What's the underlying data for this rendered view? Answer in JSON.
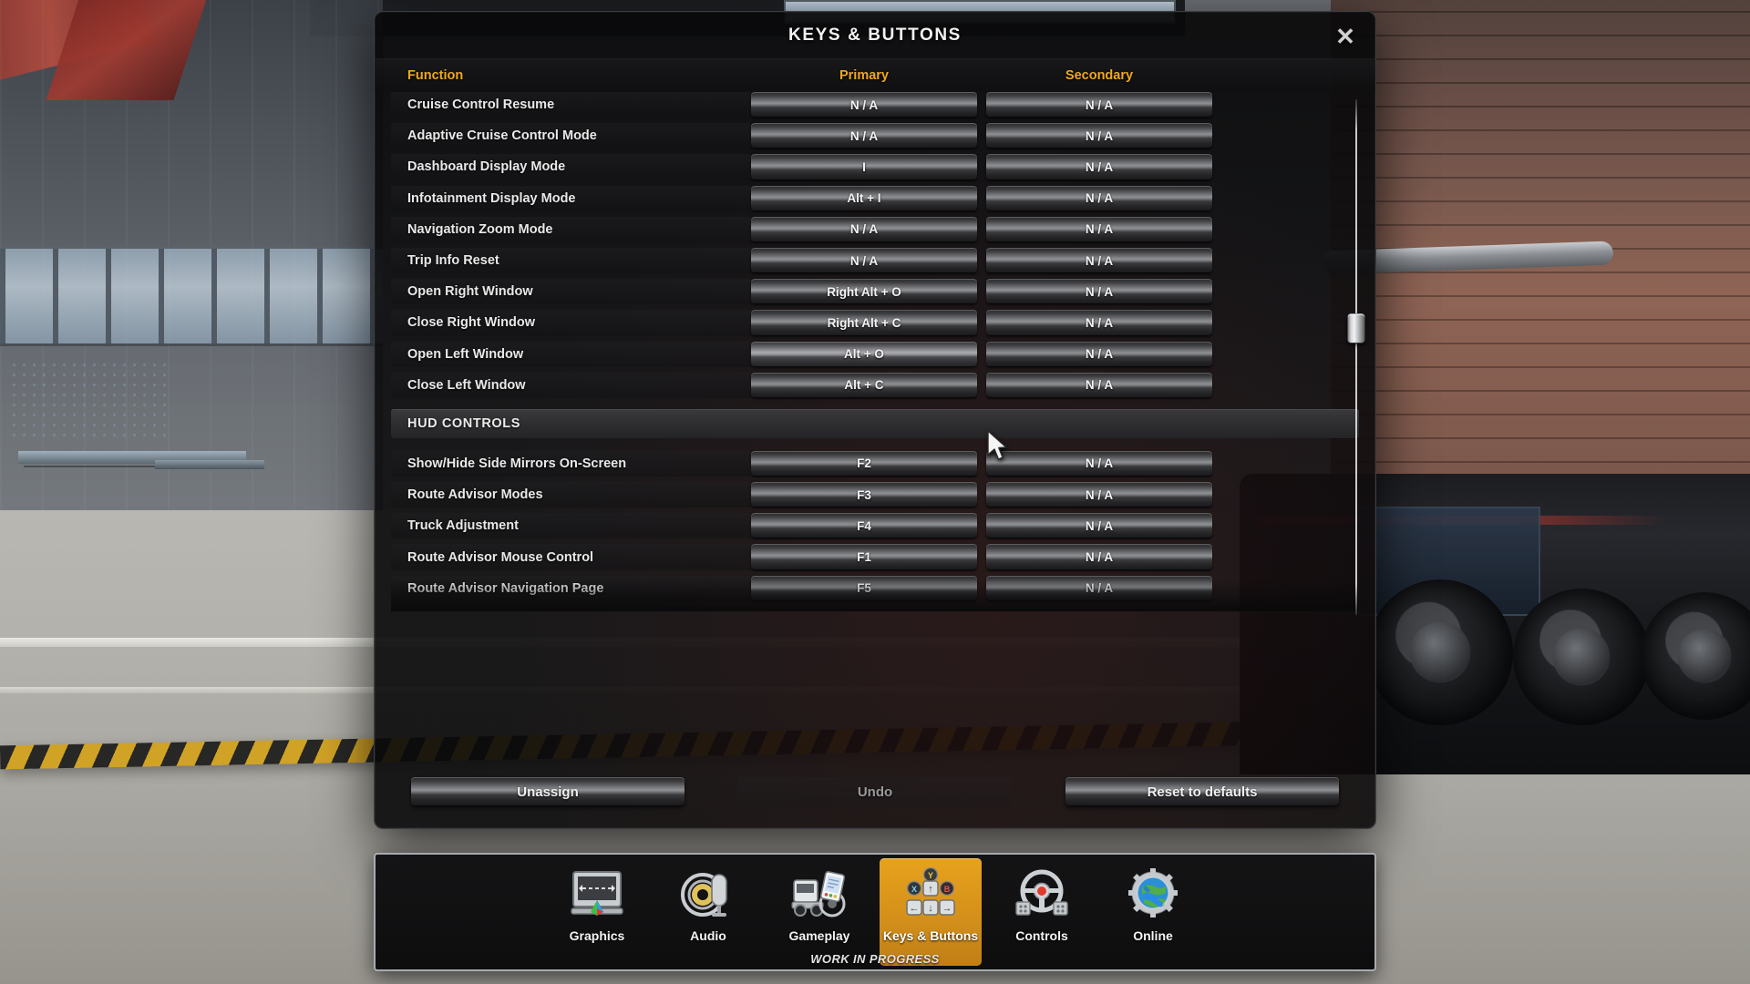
{
  "dialog": {
    "title": "KEYS & BUTTONS",
    "close_label": "✕",
    "columns": {
      "function": "Function",
      "primary": "Primary",
      "secondary": "Secondary"
    },
    "accent_color": "#f0a81e",
    "rows": [
      {
        "type": "binding",
        "name": "Cruise Control Resume",
        "primary": "N / A",
        "secondary": "N / A",
        "highlight": false
      },
      {
        "type": "binding",
        "name": "Adaptive Cruise Control Mode",
        "primary": "N / A",
        "secondary": "N / A",
        "highlight": false
      },
      {
        "type": "binding",
        "name": "Dashboard Display Mode",
        "primary": "I",
        "secondary": "N / A",
        "highlight": false
      },
      {
        "type": "binding",
        "name": "Infotainment Display Mode",
        "primary": "Alt + I",
        "secondary": "N / A",
        "highlight": false
      },
      {
        "type": "binding",
        "name": "Navigation Zoom Mode",
        "primary": "N / A",
        "secondary": "N / A",
        "highlight": false
      },
      {
        "type": "binding",
        "name": "Trip Info Reset",
        "primary": "N / A",
        "secondary": "N / A",
        "highlight": false
      },
      {
        "type": "binding",
        "name": "Open Right Window",
        "primary": "Right Alt + O",
        "secondary": "N / A",
        "highlight": false
      },
      {
        "type": "binding",
        "name": "Close Right Window",
        "primary": "Right Alt + C",
        "secondary": "N / A",
        "highlight": false
      },
      {
        "type": "binding",
        "name": "Open Left Window",
        "primary": "Alt + O",
        "secondary": "N / A",
        "highlight": true
      },
      {
        "type": "binding",
        "name": "Close Left Window",
        "primary": "Alt + C",
        "secondary": "N / A",
        "highlight": false
      },
      {
        "type": "section",
        "name": "HUD CONTROLS"
      },
      {
        "type": "binding",
        "name": "Show/Hide Side Mirrors On-Screen",
        "primary": "F2",
        "secondary": "N / A",
        "highlight": false
      },
      {
        "type": "binding",
        "name": "Route Advisor Modes",
        "primary": "F3",
        "secondary": "N / A",
        "highlight": false
      },
      {
        "type": "binding",
        "name": "Truck Adjustment",
        "primary": "F4",
        "secondary": "N / A",
        "highlight": false
      },
      {
        "type": "binding",
        "name": "Route Advisor Mouse Control",
        "primary": "F1",
        "secondary": "N / A",
        "highlight": false
      },
      {
        "type": "binding",
        "name": "Route Advisor Navigation Page",
        "primary": "F5",
        "secondary": "N / A",
        "highlight": false
      }
    ],
    "actions": [
      {
        "label": "Unassign",
        "enabled": true
      },
      {
        "label": "Undo",
        "enabled": false
      },
      {
        "label": "Reset to defaults",
        "enabled": true
      }
    ]
  },
  "tabbar": {
    "tabs": [
      {
        "id": "graphics",
        "label": "Graphics",
        "icon": "monitor-icon",
        "active": false
      },
      {
        "id": "audio",
        "label": "Audio",
        "icon": "microphone-icon",
        "active": false
      },
      {
        "id": "gameplay",
        "label": "Gameplay",
        "icon": "truck-icon",
        "active": false
      },
      {
        "id": "keys",
        "label": "Keys & Buttons",
        "icon": "keyboard-keys-icon",
        "active": true
      },
      {
        "id": "controls",
        "label": "Controls",
        "icon": "steering-wheel-icon",
        "active": false
      },
      {
        "id": "online",
        "label": "Online",
        "icon": "globe-gear-icon",
        "active": false
      }
    ],
    "status": "WORK IN PROGRESS",
    "active_color": "#e7a21c"
  }
}
